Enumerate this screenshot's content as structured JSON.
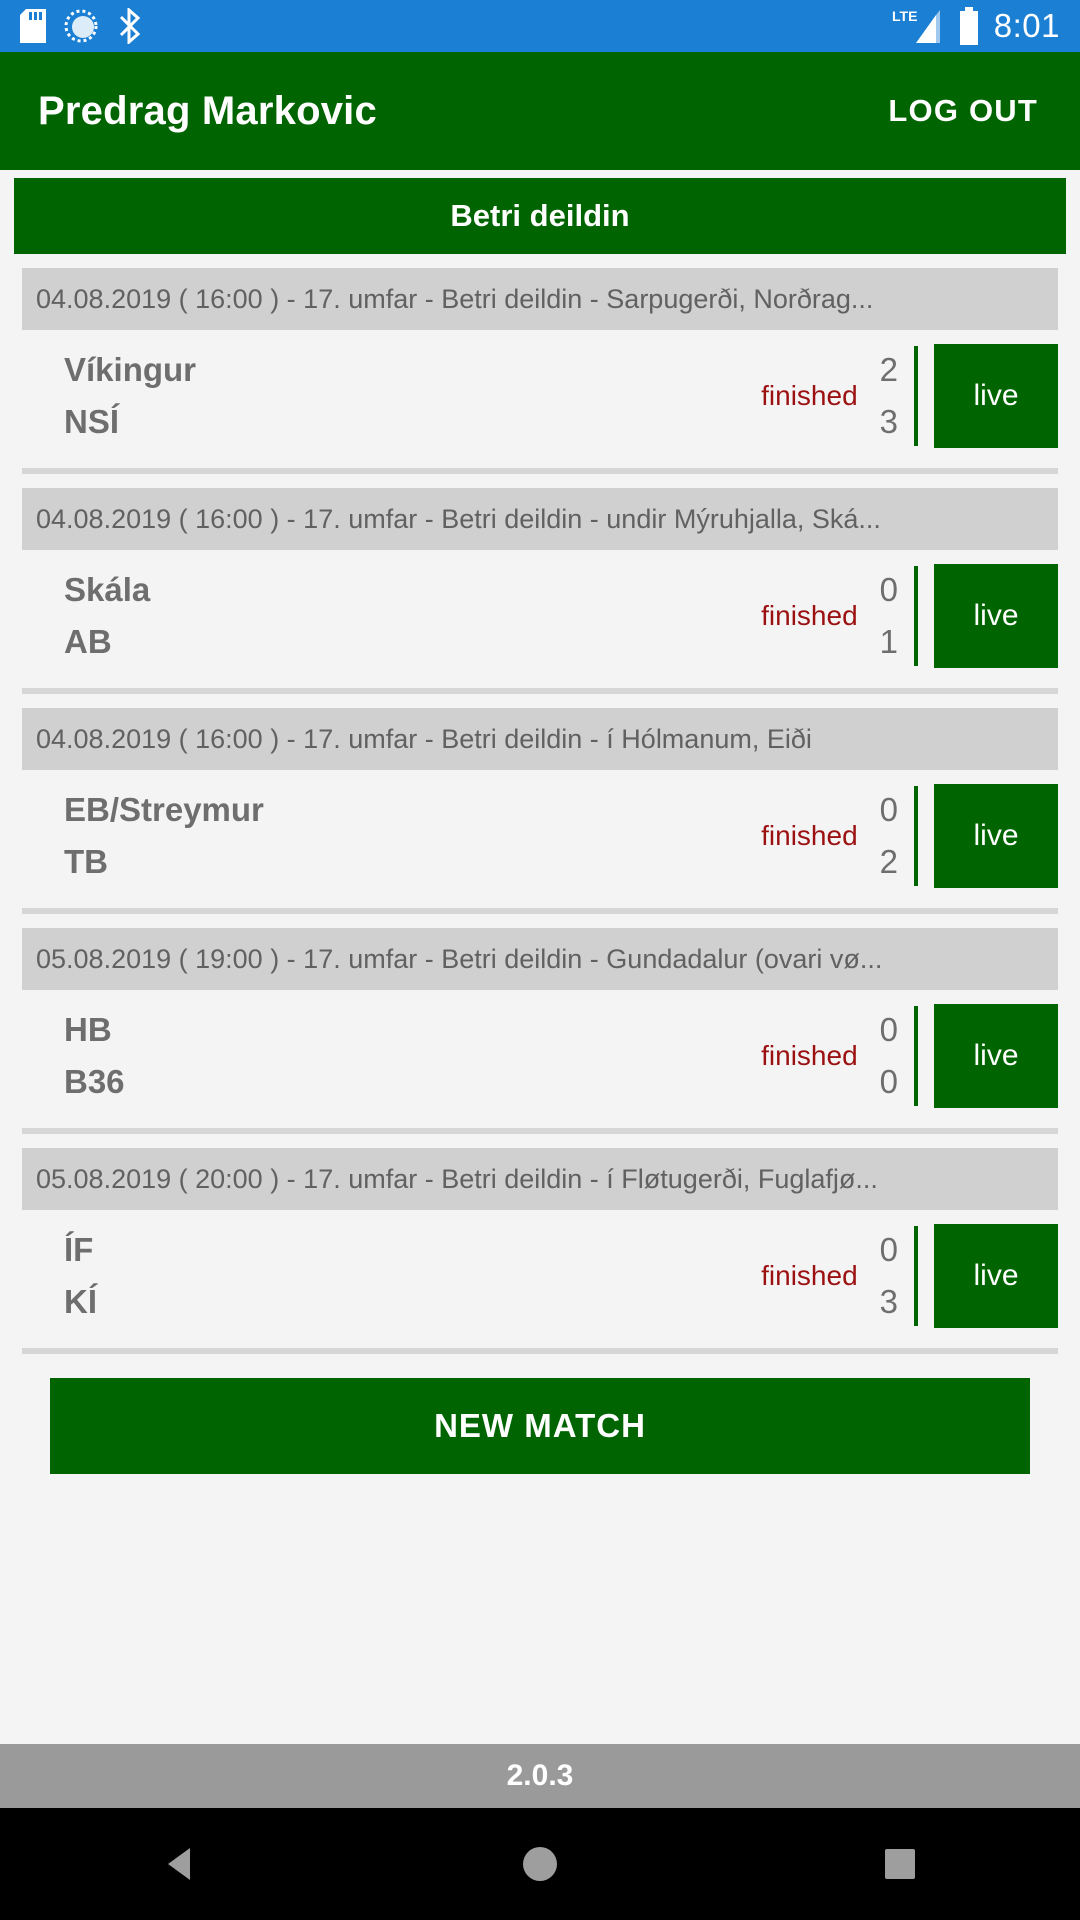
{
  "status_bar": {
    "time": "8:01",
    "icons": [
      "sd-card-icon",
      "sync-icon",
      "bluetooth-icon"
    ],
    "network_label": "LTE",
    "background": "#1b7fd4"
  },
  "app_bar": {
    "title": "Predrag Markovic",
    "logout_label": "LOG OUT",
    "background": "#006400"
  },
  "league_banner": {
    "label": "Betri deildin"
  },
  "matches": [
    {
      "meta": "04.08.2019 ( 16:00 )  -  17. umfar  -  Betri deildin  -  Sarpugerði, Norðrag...",
      "home_team": "Víkingur",
      "away_team": "NSÍ",
      "home_score": "2",
      "away_score": "3",
      "status": "finished",
      "live_label": "live"
    },
    {
      "meta": "04.08.2019 ( 16:00 )  -  17. umfar  -  Betri deildin  -  undir Mýruhjalla, Ská...",
      "home_team": "Skála",
      "away_team": "AB",
      "home_score": "0",
      "away_score": "1",
      "status": "finished",
      "live_label": "live"
    },
    {
      "meta": "04.08.2019 ( 16:00 )  -  17. umfar  -  Betri deildin  -  í Hólmanum, Eiði",
      "home_team": "EB/Streymur",
      "away_team": "TB",
      "home_score": "0",
      "away_score": "2",
      "status": "finished",
      "live_label": "live"
    },
    {
      "meta": "05.08.2019 ( 19:00 )  -  17. umfar  -  Betri deildin  -  Gundadalur (ovari vø...",
      "home_team": "HB",
      "away_team": "B36",
      "home_score": "0",
      "away_score": "0",
      "status": "finished",
      "live_label": "live"
    },
    {
      "meta": "05.08.2019 ( 20:00 )  -  17. umfar  -  Betri deildin  -  í Fløtugerði, Fuglafjø...",
      "home_team": "ÍF",
      "away_team": "KÍ",
      "home_score": "0",
      "away_score": "3",
      "status": "finished",
      "live_label": "live"
    }
  ],
  "new_match": {
    "label": "NEW MATCH"
  },
  "version_bar": {
    "version": "2.0.3"
  },
  "nav_bar": {
    "back": "back-triangle-icon",
    "home": "home-circle-icon",
    "recents": "recents-square-icon"
  },
  "colors": {
    "brand_green": "#006400",
    "status_blue": "#1b7fd4",
    "finished_red": "#9b1111",
    "meta_gray": "#d0d0d0"
  }
}
